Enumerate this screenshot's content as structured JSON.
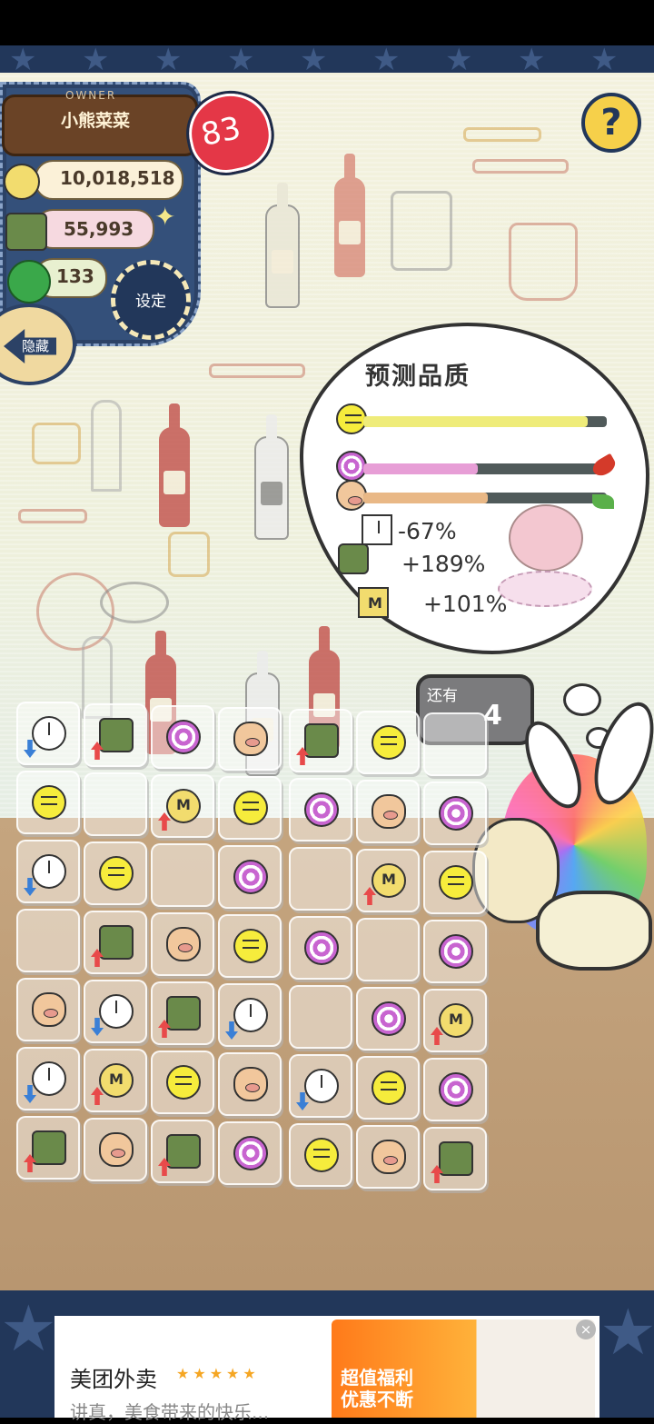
{
  "owner": {
    "label": "OWNER",
    "name": "小熊菜菜",
    "level": "83"
  },
  "resources": {
    "coins": "10,018,518",
    "ingredients": "55,993",
    "clovers": "133"
  },
  "buttons": {
    "settings": "设定",
    "hide": "隐藏",
    "help": "?"
  },
  "quality": {
    "title": "预测品质",
    "bars": [
      {
        "icon": "smiley-icon",
        "fill": 0.92,
        "color": "#efec7a"
      },
      {
        "icon": "lollipop-icon",
        "fill": 0.47,
        "color": "#e79ed6"
      },
      {
        "icon": "pig-icon",
        "fill": 0.51,
        "color": "#e9b886"
      }
    ],
    "stats": [
      {
        "icon": "clock-icon",
        "text": "-67%"
      },
      {
        "icon": "basket-icon",
        "text": "+189%"
      },
      {
        "icon": "coin-icon",
        "text": "+101%"
      }
    ]
  },
  "remaining": {
    "label": "还有",
    "count": "4"
  },
  "grid": [
    [
      {
        "icon": "clock",
        "arrow": "down"
      },
      {
        "icon": "basket",
        "arrow": "up"
      },
      {
        "icon": "lollipop"
      },
      {
        "icon": "pig"
      },
      {
        "icon": "basket",
        "arrow": "up"
      },
      {
        "icon": "smiley"
      },
      {
        "icon": ""
      }
    ],
    [
      {
        "icon": "smiley"
      },
      {
        "icon": ""
      },
      {
        "icon": "coin",
        "arrow": "up"
      },
      {
        "icon": "smiley"
      },
      {
        "icon": "lollipop"
      },
      {
        "icon": "pig"
      },
      {
        "icon": "lollipop"
      }
    ],
    [
      {
        "icon": "clock",
        "arrow": "down"
      },
      {
        "icon": "smiley"
      },
      {
        "icon": ""
      },
      {
        "icon": "lollipop"
      },
      {
        "icon": ""
      },
      {
        "icon": "coin",
        "arrow": "up"
      },
      {
        "icon": "smiley"
      }
    ],
    [
      {
        "icon": ""
      },
      {
        "icon": "basket",
        "arrow": "up"
      },
      {
        "icon": "pig"
      },
      {
        "icon": "smiley"
      },
      {
        "icon": "lollipop"
      },
      {
        "icon": ""
      },
      {
        "icon": "lollipop"
      }
    ],
    [
      {
        "icon": "pig"
      },
      {
        "icon": "clock",
        "arrow": "down"
      },
      {
        "icon": "basket",
        "arrow": "up"
      },
      {
        "icon": "clock",
        "arrow": "down"
      },
      {
        "icon": ""
      },
      {
        "icon": "lollipop"
      },
      {
        "icon": "coin",
        "arrow": "up"
      }
    ],
    [
      {
        "icon": "clock",
        "arrow": "down"
      },
      {
        "icon": "coin",
        "arrow": "up"
      },
      {
        "icon": "smiley"
      },
      {
        "icon": "pig"
      },
      {
        "icon": "clock",
        "arrow": "down"
      },
      {
        "icon": "smiley"
      },
      {
        "icon": "lollipop"
      }
    ],
    [
      {
        "icon": "basket",
        "arrow": "up"
      },
      {
        "icon": "pig"
      },
      {
        "icon": "basket",
        "arrow": "up"
      },
      {
        "icon": "lollipop"
      },
      {
        "icon": "smiley"
      },
      {
        "icon": "pig"
      },
      {
        "icon": "basket",
        "arrow": "up"
      }
    ]
  ],
  "ad": {
    "title": "美团外卖",
    "rating": "★★★★★",
    "subtitle": "讲真，美食带来的快乐...",
    "banner_line1": "超值福利",
    "banner_line2": "优惠不断",
    "close": "×"
  }
}
